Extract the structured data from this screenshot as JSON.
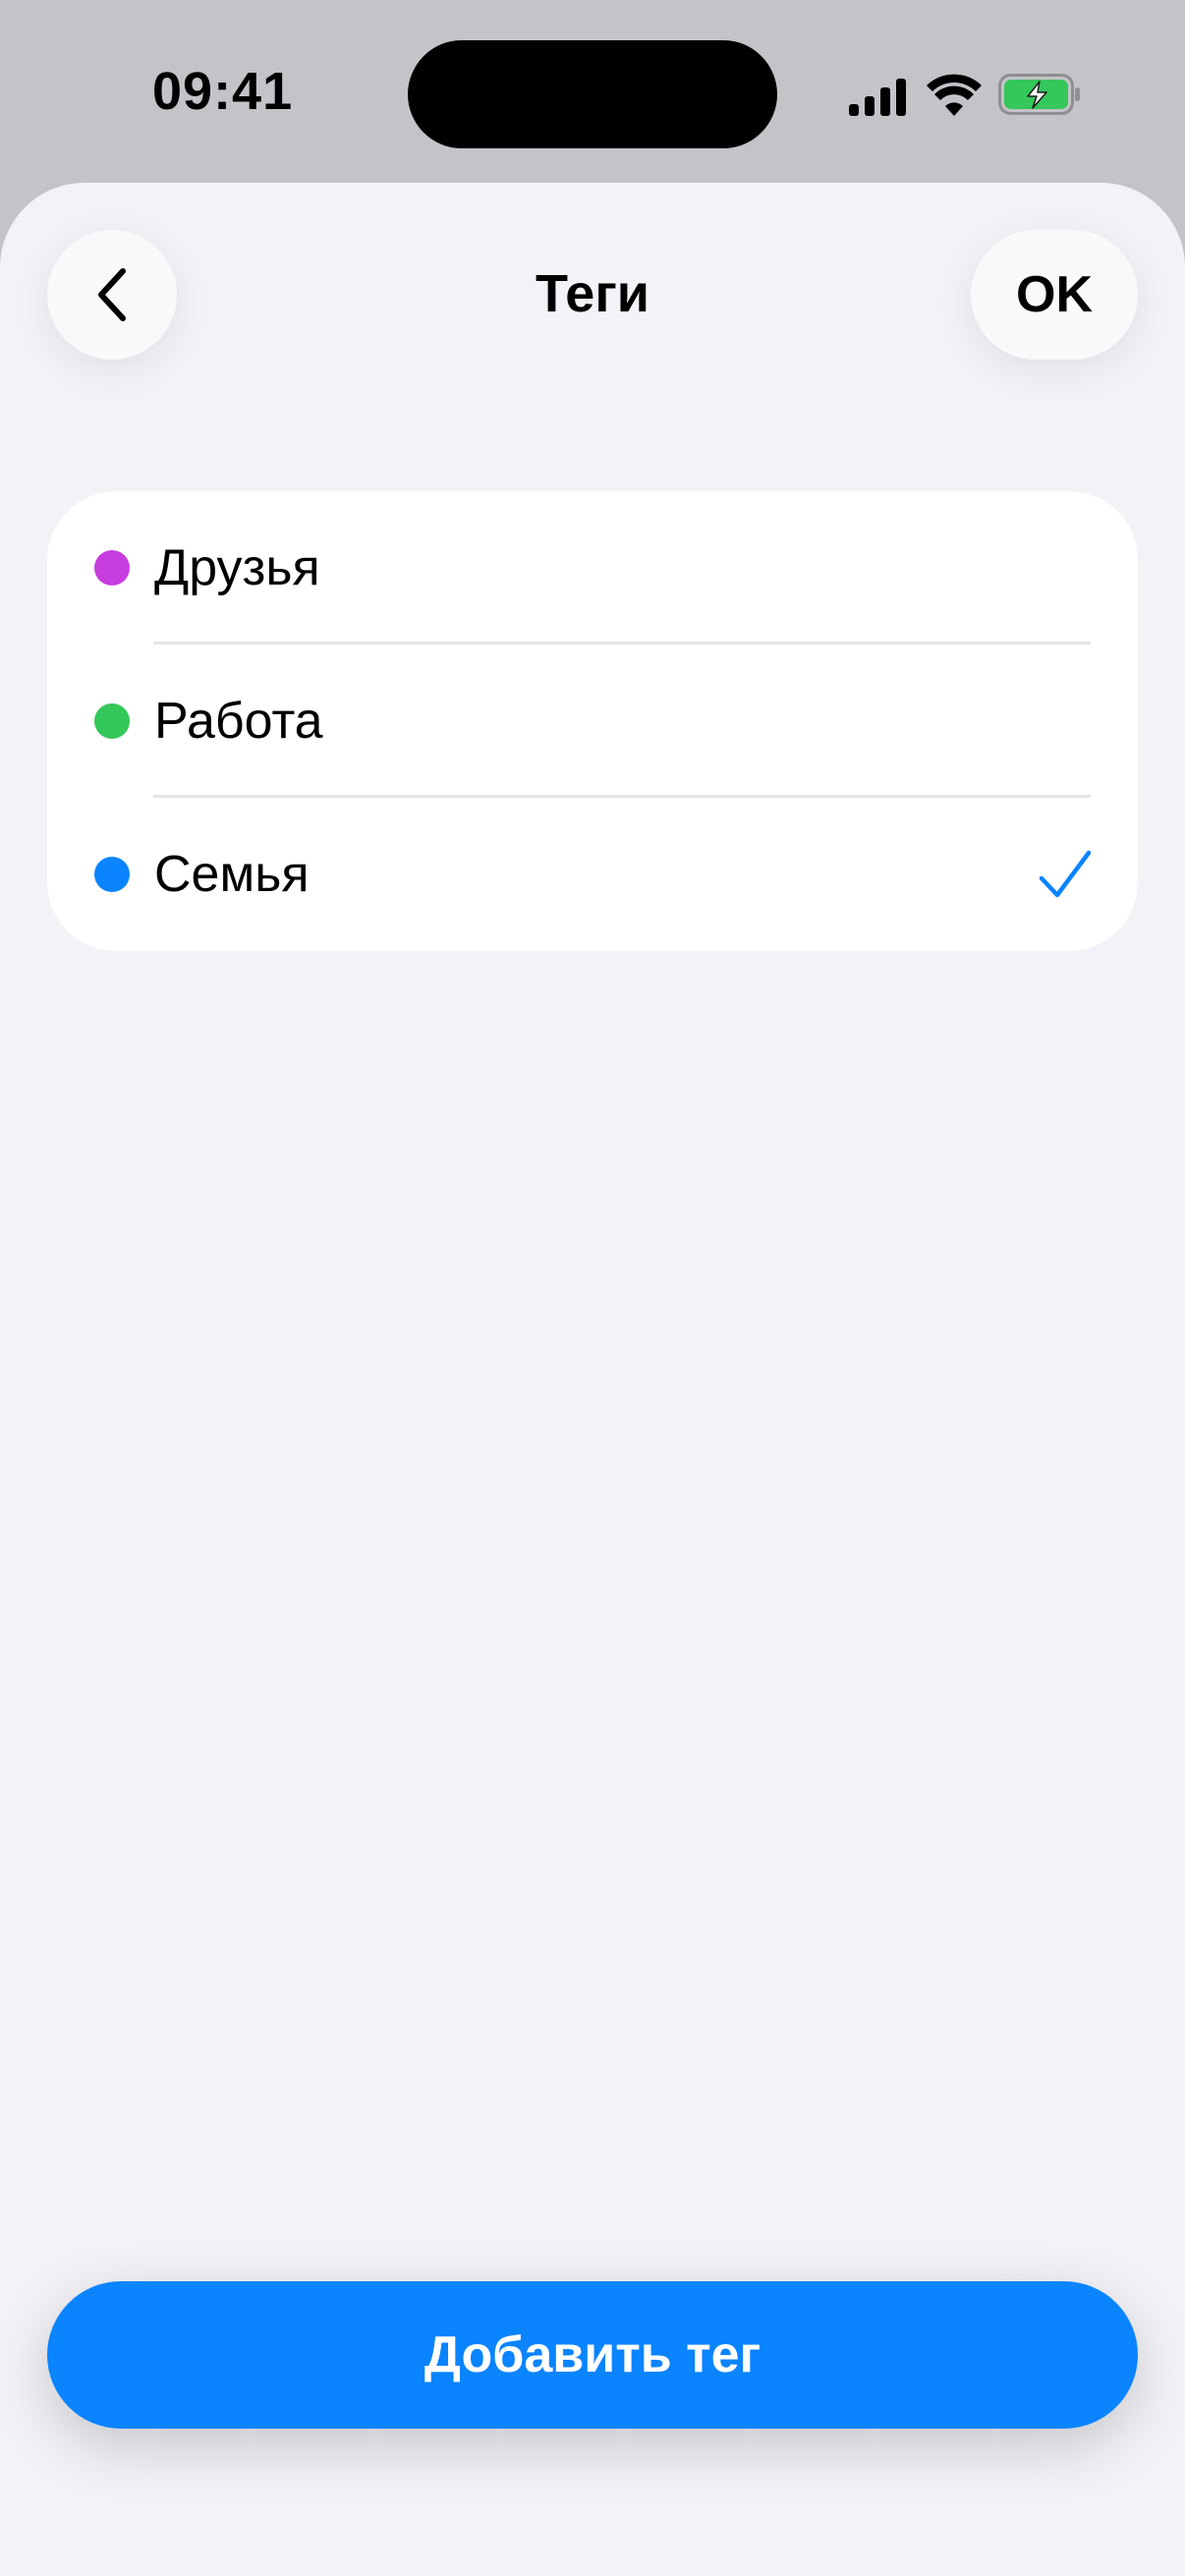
{
  "status_bar": {
    "time": "09:41"
  },
  "header": {
    "title": "Теги",
    "back_icon": "chevron-left-icon",
    "ok_label": "OK"
  },
  "tags": [
    {
      "label": "Друзья",
      "color": "#c63dde",
      "selected": false
    },
    {
      "label": "Работа",
      "color": "#34c759",
      "selected": false
    },
    {
      "label": "Семья",
      "color": "#0a84ff",
      "selected": true
    }
  ],
  "colors": {
    "accent": "#0a84ff",
    "sheet_background": "#f2f2f7",
    "battery_fill": "#34c759"
  },
  "footer": {
    "add_button_label": "Добавить тег"
  }
}
